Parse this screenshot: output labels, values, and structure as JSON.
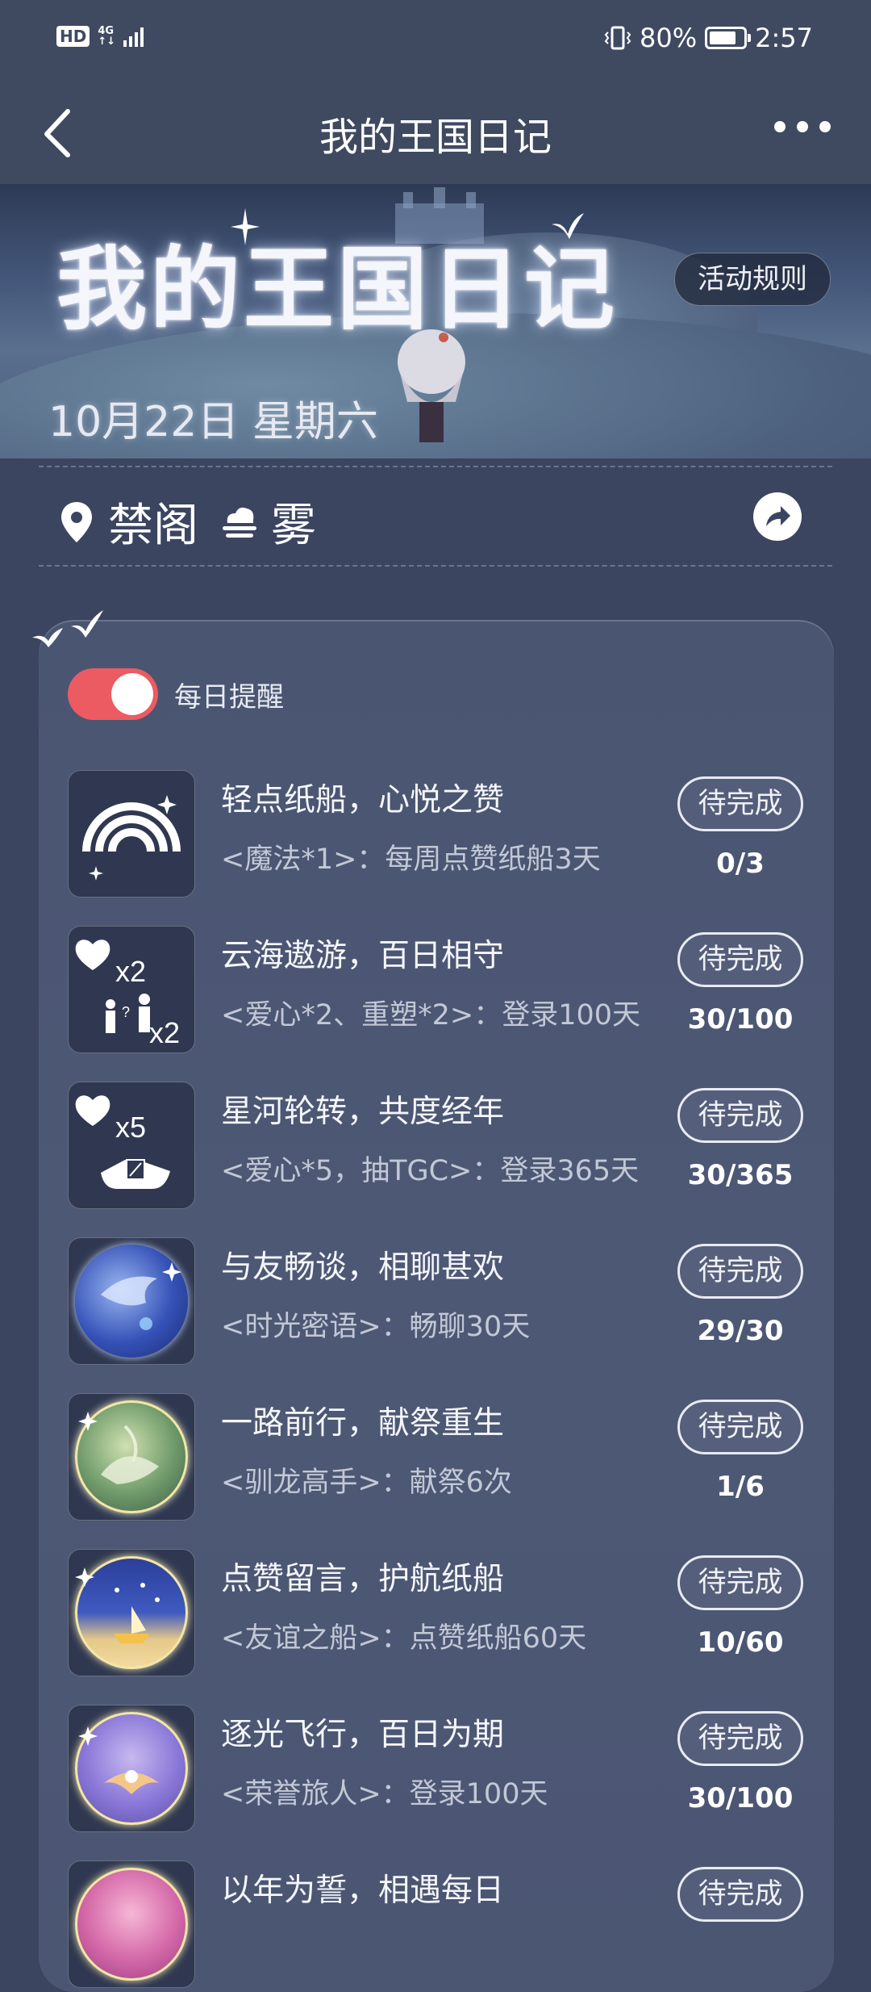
{
  "status_bar": {
    "hd": "HD",
    "net_top": "4G",
    "net_bottom": "↑↓",
    "battery_percent": "80%",
    "battery_level": 0.8,
    "time": "2:57"
  },
  "app_bar": {
    "title": "我的王国日记",
    "back_icon": "chevron-left-icon",
    "more_icon": "more-dots-icon"
  },
  "hero": {
    "title": "我的王国日记",
    "rules_button": "活动规则",
    "date": "10月22日  星期六"
  },
  "location": {
    "place": "禁阁",
    "weather": "雾",
    "place_icon": "location-pin-icon",
    "weather_icon": "fog-icon",
    "share_icon": "share-icon"
  },
  "reminder": {
    "label": "每日提醒",
    "enabled": true,
    "accent": "#ec5b61"
  },
  "tasks": [
    {
      "title": "轻点纸船，心悦之赞",
      "desc": "<魔法*1>：每周点赞纸船3天",
      "button": "待完成",
      "progress": "0/3",
      "icon": "rainbow-icon"
    },
    {
      "title": "云海遨游，百日相守",
      "desc": "<爱心*2、重塑*2>：登录100天",
      "button": "待完成",
      "progress": "30/100",
      "icon": "heart-reshape-icon"
    },
    {
      "title": "星河轮转，共度经年",
      "desc": "<爱心*5，抽TGC>：登录365天",
      "button": "待完成",
      "progress": "30/365",
      "icon": "heart-cape-icon"
    },
    {
      "title": "与友畅谈，相聊甚欢",
      "desc": "<时光密语>：畅聊30天",
      "button": "待完成",
      "progress": "29/30",
      "icon": "whale-badge-icon"
    },
    {
      "title": "一路前行，献祭重生",
      "desc": "<驯龙高手>：献祭6次",
      "button": "待完成",
      "progress": "1/6",
      "icon": "dragon-badge-icon"
    },
    {
      "title": "点赞留言，护航纸船",
      "desc": "<友谊之船>：点赞纸船60天",
      "button": "待完成",
      "progress": "10/60",
      "icon": "boat-badge-icon"
    },
    {
      "title": "逐光飞行，百日为期",
      "desc": "<荣誉旅人>：登录100天",
      "button": "待完成",
      "progress": "30/100",
      "icon": "flight-badge-icon"
    },
    {
      "title": "以年为誓，相遇每日",
      "desc": "",
      "button": "待完成",
      "progress": "",
      "icon": "year-badge-icon"
    }
  ],
  "icon_text": {
    "x2a": "x2",
    "x2b": "x2",
    "x5": "x5"
  }
}
